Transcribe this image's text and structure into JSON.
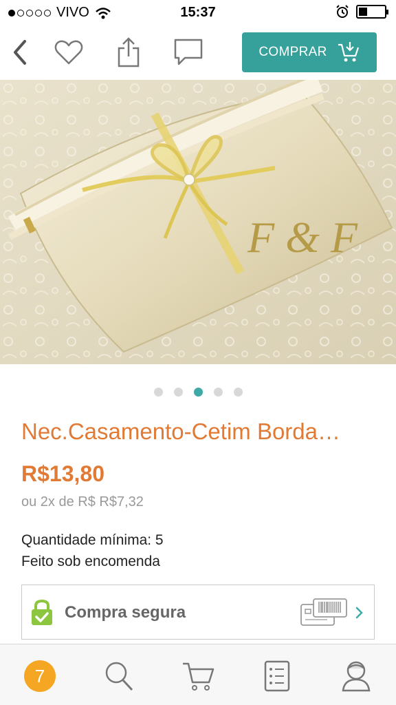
{
  "status_bar": {
    "carrier": "VIVO",
    "time": "15:37"
  },
  "toolbar": {
    "buy_label": "COMPRAR",
    "icons": [
      "back-chevron-icon",
      "heart-icon",
      "share-icon",
      "chat-icon",
      "cart-download-icon"
    ]
  },
  "carousel": {
    "dots": 5,
    "active_index": 2,
    "image_monogram": "F & F"
  },
  "product": {
    "title": "Nec.Casamento-Cetim Borda…",
    "price": "R$13,80",
    "installments": "ou 2x de R$ R$7,32",
    "min_quantity": "Quantidade mínima: 5",
    "made_to_order": "Feito sob encomenda"
  },
  "secure": {
    "label": "Compra segura"
  },
  "tabbar": {
    "badge_count": "7",
    "tabs": [
      "home-badge",
      "search-icon",
      "cart-icon",
      "list-icon",
      "profile-icon"
    ]
  },
  "colors": {
    "accent_teal": "#36a09a",
    "price_orange": "#e07a35",
    "badge_orange": "#f5a623",
    "lock_green": "#8cc63f"
  }
}
